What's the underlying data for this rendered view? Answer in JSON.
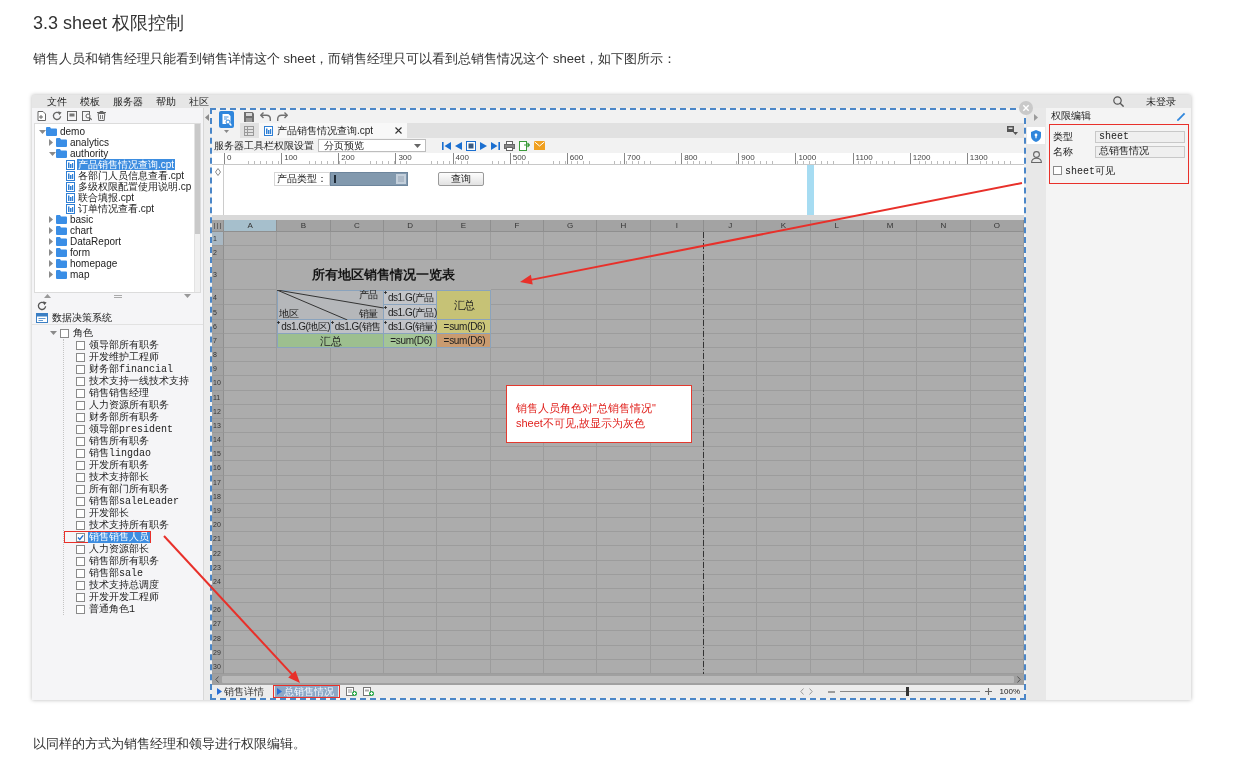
{
  "heading": "3.3 sheet 权限控制",
  "intro": "销售人员和销售经理只能看到销售详情这个 sheet，而销售经理只可以看到总销售情况这个 sheet，如下图所示：",
  "screenshot": {
    "menu": [
      "文件",
      "模板",
      "服务器",
      "帮助",
      "社区"
    ],
    "login": "未登录",
    "file_tree": [
      {
        "label": "demo",
        "kind": "folder",
        "expanded": true,
        "selected": false,
        "children": [
          {
            "label": "analytics",
            "kind": "folder",
            "expanded": false,
            "selected": false
          },
          {
            "label": "authority",
            "kind": "folder",
            "expanded": true,
            "selected": false,
            "children": [
              {
                "label": "产品销售情况查询.cpt",
                "kind": "file",
                "selected": true
              },
              {
                "label": "各部门人员信息查看.cpt",
                "kind": "file",
                "selected": false
              },
              {
                "label": "多级权限配置使用说明.cp",
                "kind": "file",
                "selected": false
              },
              {
                "label": "联合填报.cpt",
                "kind": "file",
                "selected": false
              },
              {
                "label": "订单情况查看.cpt",
                "kind": "file",
                "selected": false
              }
            ]
          },
          {
            "label": "basic",
            "kind": "folder",
            "expanded": false,
            "selected": false
          },
          {
            "label": "chart",
            "kind": "folder",
            "expanded": false,
            "selected": false
          },
          {
            "label": "DataReport",
            "kind": "folder",
            "expanded": false,
            "selected": false
          },
          {
            "label": "form",
            "kind": "folder",
            "expanded": false,
            "selected": false
          },
          {
            "label": "homepage",
            "kind": "folder",
            "expanded": false,
            "selected": false
          },
          {
            "label": "map",
            "kind": "folder",
            "expanded": false,
            "selected": false
          }
        ]
      }
    ],
    "system_title": "数据决策系统",
    "roles": [
      {
        "label": "角色",
        "checked": false,
        "selected": false,
        "annotated": false,
        "expanded": true,
        "children": [
          {
            "label": "领导部所有职务",
            "checked": false,
            "selected": false,
            "annotated": false
          },
          {
            "label": "开发维护工程师",
            "checked": false,
            "selected": false,
            "annotated": false
          },
          {
            "label": "财务部financial",
            "checked": false,
            "selected": false,
            "annotated": false
          },
          {
            "label": "技术支持一线技术支持",
            "checked": false,
            "selected": false,
            "annotated": false
          },
          {
            "label": "销售销售经理",
            "checked": false,
            "selected": false,
            "annotated": false
          },
          {
            "label": "人力资源所有职务",
            "checked": false,
            "selected": false,
            "annotated": false
          },
          {
            "label": "财务部所有职务",
            "checked": false,
            "selected": false,
            "annotated": false
          },
          {
            "label": "领导部president",
            "checked": false,
            "selected": false,
            "annotated": false
          },
          {
            "label": "销售所有职务",
            "checked": false,
            "selected": false,
            "annotated": false
          },
          {
            "label": "销售lingdao",
            "checked": false,
            "selected": false,
            "annotated": false
          },
          {
            "label": "开发所有职务",
            "checked": false,
            "selected": false,
            "annotated": false
          },
          {
            "label": "技术支持部长",
            "checked": false,
            "selected": false,
            "annotated": false
          },
          {
            "label": "所有部门所有职务",
            "checked": false,
            "selected": false,
            "annotated": false
          },
          {
            "label": "销售部saleLeader",
            "checked": false,
            "selected": false,
            "annotated": false
          },
          {
            "label": "开发部长",
            "checked": false,
            "selected": false,
            "annotated": false
          },
          {
            "label": "技术支持所有职务",
            "checked": false,
            "selected": false,
            "annotated": false
          },
          {
            "label": "销售销售人员",
            "checked": true,
            "selected": true,
            "annotated": true
          },
          {
            "label": "人力资源部长",
            "checked": false,
            "selected": false,
            "annotated": false
          },
          {
            "label": "销售部所有职务",
            "checked": false,
            "selected": false,
            "annotated": false
          },
          {
            "label": "销售部sale",
            "checked": false,
            "selected": false,
            "annotated": false
          },
          {
            "label": "技术支持总调度",
            "checked": false,
            "selected": false,
            "annotated": false
          },
          {
            "label": "开发开发工程师",
            "checked": false,
            "selected": false,
            "annotated": false
          },
          {
            "label": "普通角色1",
            "checked": false,
            "selected": false,
            "annotated": false
          }
        ]
      }
    ],
    "editor": {
      "tab": "产品销售情况查询.cpt",
      "toolbar_label": "服务器工具栏权限设置",
      "mode": "分页预览",
      "ruler": [
        "0",
        "100",
        "200",
        "300",
        "400",
        "500",
        "600",
        "700",
        "800",
        "900",
        "1000",
        "1100",
        "1200",
        "1300"
      ],
      "parameter": {
        "label": "产品类型：",
        "button": "查询"
      },
      "columns": [
        {
          "label": "A",
          "selected": true
        },
        {
          "label": "B",
          "selected": false
        },
        {
          "label": "C",
          "selected": false
        },
        {
          "label": "D",
          "selected": false
        },
        {
          "label": "E",
          "selected": false
        },
        {
          "label": "F",
          "selected": false
        },
        {
          "label": "G",
          "selected": false
        },
        {
          "label": "H",
          "selected": false
        },
        {
          "label": "I",
          "selected": false
        },
        {
          "label": "J",
          "selected": false
        },
        {
          "label": "K",
          "selected": false
        },
        {
          "label": "L",
          "selected": false
        },
        {
          "label": "M",
          "selected": false
        },
        {
          "label": "N",
          "selected": false
        },
        {
          "label": "O",
          "selected": false
        }
      ],
      "rows": [
        {
          "label": "1",
          "selected": true
        },
        {
          "label": "2",
          "selected": false
        },
        {
          "label": "3",
          "selected": false
        },
        {
          "label": "4",
          "selected": false
        },
        {
          "label": "5",
          "selected": false
        },
        {
          "label": "6",
          "selected": false
        },
        {
          "label": "7",
          "selected": false
        },
        {
          "label": "8",
          "selected": false
        },
        {
          "label": "9",
          "selected": false
        },
        {
          "label": "10",
          "selected": false
        },
        {
          "label": "11",
          "selected": false
        },
        {
          "label": "12",
          "selected": false
        },
        {
          "label": "13",
          "selected": false
        },
        {
          "label": "14",
          "selected": false
        },
        {
          "label": "15",
          "selected": false
        },
        {
          "label": "16",
          "selected": false
        },
        {
          "label": "17",
          "selected": false
        },
        {
          "label": "18",
          "selected": false
        },
        {
          "label": "19",
          "selected": false
        },
        {
          "label": "20",
          "selected": false
        },
        {
          "label": "21",
          "selected": false
        },
        {
          "label": "22",
          "selected": false
        },
        {
          "label": "23",
          "selected": false
        },
        {
          "label": "24",
          "selected": false
        },
        {
          "selected": false
        },
        {
          "label": "26",
          "selected": false
        },
        {
          "label": "27",
          "selected": false
        },
        {
          "label": "28",
          "selected": false
        },
        {
          "label": "29",
          "selected": false
        },
        {
          "label": "30",
          "selected": false
        }
      ],
      "report": {
        "title": "所有地区销售情况一览表",
        "corner": [
          "产品",
          "销量",
          "地区"
        ],
        "column_group": "ds1.G(产品",
        "column_item": "ds1.G(产品)",
        "total_header": "汇总",
        "row_group": "ds1.G(地区)",
        "row_item": "ds1.G(销售",
        "value": "ds1.G(销量)",
        "row_total": "=sum(D6)",
        "total_label": "汇总",
        "column_total": "=sum(D6)",
        "grand_total": "=sum(D6)"
      },
      "sheet_tabs": [
        {
          "label": "销售详情",
          "selected": false,
          "annotated": false
        },
        {
          "label": "总销售情况",
          "selected": true,
          "annotated": true
        }
      ],
      "zoom": {
        "level": 0.48,
        "reading": "100%"
      }
    },
    "side_tabs": [
      {
        "kind": "permission",
        "selected": true
      },
      {
        "kind": "user",
        "selected": false
      }
    ],
    "permission_panel": {
      "title": "权限编辑",
      "annotated": true,
      "fields": [
        {
          "label": "类型",
          "value": "sheet"
        },
        {
          "label": "名称",
          "value": "总销售情况"
        }
      ],
      "visibility": {
        "label": "sheet可见",
        "checked": false
      }
    },
    "callout": "销售人员角色对\"总销售情况\" sheet不可见,故显示为灰色"
  },
  "outro": "以同样的方式为销售经理和领导进行权限编辑。"
}
